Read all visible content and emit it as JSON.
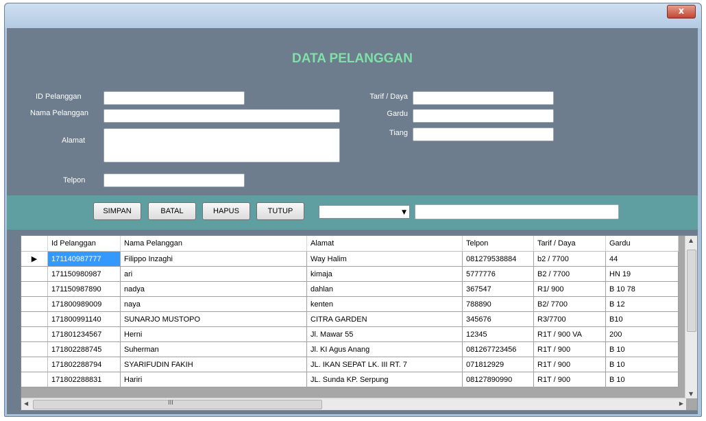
{
  "window": {
    "close_glyph": "x"
  },
  "form": {
    "title": "DATA PELANGGAN",
    "labels": {
      "id": "ID Pelanggan",
      "nama": "Nama Pelanggan",
      "alamat": "Alamat",
      "telpon": "Telpon",
      "tarif": "Tarif / Daya",
      "gardu": "Gardu",
      "tiang": "Tiang"
    },
    "values": {
      "id": "",
      "nama": "",
      "alamat": "",
      "telpon": "",
      "tarif": "",
      "gardu": "",
      "tiang": "",
      "search": ""
    }
  },
  "toolbar": {
    "simpan": "SIMPAN",
    "batal": "BATAL",
    "hapus": "HAPUS",
    "tutup": "TUTUP",
    "combo_value": ""
  },
  "grid": {
    "columns": [
      "Id Pelanggan",
      "Nama Pelanggan",
      "Alamat",
      "Telpon",
      "Tarif / Daya",
      "Gardu"
    ],
    "rows": [
      [
        "171140987777",
        "Filippo Inzaghi",
        "Way Halim",
        "081279538884",
        "b2 / 7700",
        "44"
      ],
      [
        "171150980987",
        "ari",
        "kimaja",
        "5777776",
        "B2 / 7700",
        "HN 19"
      ],
      [
        "171150987890",
        "nadya",
        "dahlan",
        "367547",
        "R1/ 900",
        "B 10 78"
      ],
      [
        "171800989009",
        "naya",
        "kenten",
        "788890",
        "B2/ 7700",
        "B 12"
      ],
      [
        "171800991140",
        "SUNARJO MUSTOPO",
        "CITRA GARDEN",
        "345676",
        "R3/7700",
        "B10"
      ],
      [
        "171801234567",
        "Herni",
        "Jl. Mawar 55",
        "12345",
        "R1T / 900 VA",
        "200"
      ],
      [
        "171802288745",
        "Suherman",
        "Jl. KI Agus Anang",
        "081267723456",
        "R1T / 900",
        "B 10"
      ],
      [
        "171802288794",
        "SYARIFUDIN FAKIH",
        "JL. IKAN SEPAT LK. III RT. 7",
        "071812929",
        "R1T / 900",
        "B 10"
      ],
      [
        "171802288831",
        "Hariri",
        "JL. Sunda KP. Serpung",
        "08127890990",
        "R1T / 900",
        "B 10"
      ]
    ],
    "current_row_glyph": "▶",
    "hscroll_grip": "III"
  }
}
